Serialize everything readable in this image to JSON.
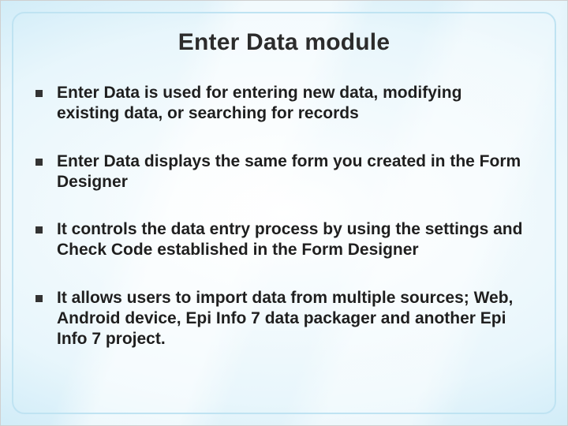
{
  "title": "Enter Data module",
  "bullets": [
    {
      "bold_prefix": "Enter Data",
      "rest": " is used for entering new data, modifying existing data, or searching for records"
    },
    {
      "bold_prefix": "Enter Data",
      "rest": " displays the same form you created in the Form Designer"
    },
    {
      "bold_prefix": "",
      "rest": "It controls the data entry process by using the settings and Check Code established in the Form Designer"
    },
    {
      "bold_prefix": "",
      "rest": "It allows users to import data from multiple sources; Web, Android device, Epi Info 7 data packager and another Epi Info 7 project."
    }
  ]
}
